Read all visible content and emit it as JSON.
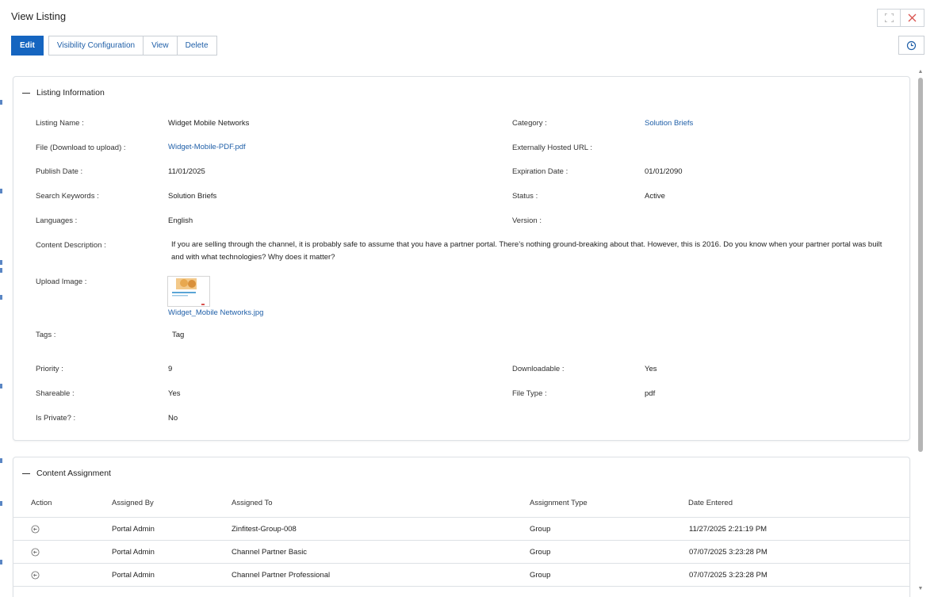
{
  "window": {
    "title": "View Listing",
    "maximize_icon": "expand-icon",
    "close_icon": "close-icon"
  },
  "toolbar": {
    "edit": "Edit",
    "visibility": "Visibility Configuration",
    "view": "View",
    "delete": "Delete",
    "history_icon": "history-icon"
  },
  "listing_info": {
    "heading": "Listing Information",
    "listing_name_label": "Listing Name :",
    "listing_name": "Widget Mobile Networks",
    "category_label": "Category :",
    "category": "Solution Briefs",
    "file_label": "File (Download to upload) :",
    "file": "Widget-Mobile-PDF.pdf",
    "hosted_url_label": "Externally Hosted URL :",
    "hosted_url": "",
    "publish_date_label": "Publish Date :",
    "publish_date": "11/01/2025",
    "expiration_date_label": "Expiration Date :",
    "expiration_date": "01/01/2090",
    "keywords_label": "Search Keywords :",
    "keywords": "Solution Briefs",
    "status_label": "Status :",
    "status": "Active",
    "languages_label": "Languages :",
    "languages": "English",
    "version_label": "Version :",
    "version": "",
    "description_label": "Content Description :",
    "description": "If you are selling through the channel, it is probably safe to assume that you have a partner portal. There’s nothing ground-breaking about that. However, this is 2016. Do you know when your partner portal was built and with what technologies? Why does it matter?",
    "upload_image_label": "Upload Image :",
    "upload_image_file": "Widget_Mobile Networks.jpg",
    "tags_label": "Tags :",
    "tags": "Tag",
    "priority_label": "Priority :",
    "priority": "9",
    "downloadable_label": "Downloadable :",
    "downloadable": "Yes",
    "shareable_label": "Shareable :",
    "shareable": "Yes",
    "file_type_label": "File Type :",
    "file_type": "pdf",
    "private_label": "Is Private? :",
    "private": "No"
  },
  "assignment": {
    "heading": "Content Assignment",
    "columns": [
      "Action",
      "Assigned By",
      "Assigned To",
      "Assignment Type",
      "Date Entered"
    ],
    "rows": [
      {
        "by": "Portal Admin",
        "to": "Zinfitest-Group-008",
        "type": "Group",
        "date": "11/27/2025 2:21:19 PM"
      },
      {
        "by": "Portal Admin",
        "to": "Channel Partner Basic",
        "type": "Group",
        "date": "07/07/2025 3:23:28 PM"
      },
      {
        "by": "Portal Admin",
        "to": "Channel Partner Professional",
        "type": "Group",
        "date": "07/07/2025 3:23:28 PM"
      }
    ],
    "action_icon": "revoke-icon"
  },
  "colors": {
    "accent": "#1565c0",
    "link": "#1f5fa8",
    "close": "#d9534f"
  }
}
